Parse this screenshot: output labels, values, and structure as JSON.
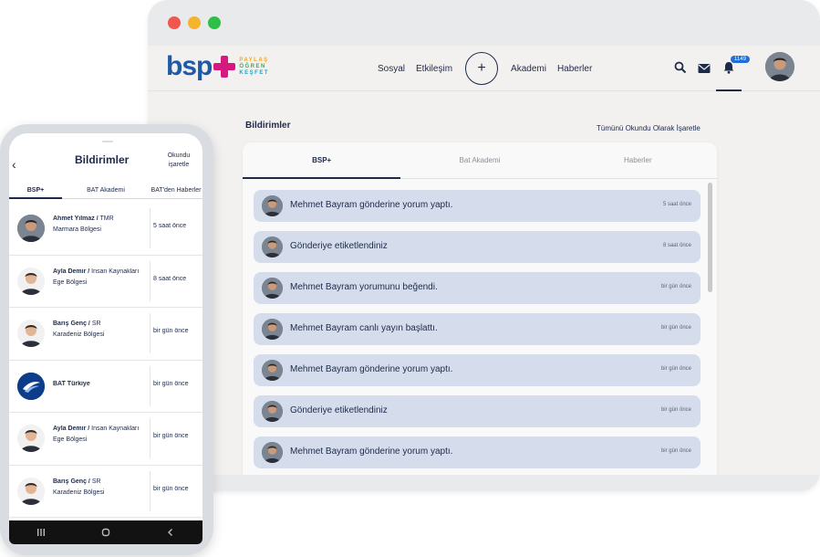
{
  "desktop": {
    "logo": {
      "text": "bsp",
      "tags": [
        "PAYLAŞ",
        "ÖĞREN",
        "KEŞFET"
      ]
    },
    "menu": [
      "Sosyal",
      "Etkileşim",
      "Akademi",
      "Haberler"
    ],
    "plus_label": "+",
    "badge": "1149",
    "page_title": "Bildirimler",
    "mark_all": "Tümünü Okundu Olarak İşaretle",
    "tabs": [
      "BSP+",
      "Bat Akademi",
      "Haberler"
    ],
    "notifications": [
      {
        "text": "Mehmet Bayram gönderine yorum yaptı.",
        "time": "5 saat önce"
      },
      {
        "text": "Gönderiye etiketlendiniz",
        "time": "8 saat önce"
      },
      {
        "text": "Mehmet Bayram yorumunu beğendi.",
        "time": "bir gün önce"
      },
      {
        "text": "Mehmet Bayram canlı yayın başlattı.",
        "time": "bir gün önce"
      },
      {
        "text": "Mehmet Bayram gönderine yorum yaptı.",
        "time": "bir gün önce"
      },
      {
        "text": "Gönderiye etiketlendiniz",
        "time": "bir gün önce"
      },
      {
        "text": "Mehmet Bayram gönderine yorum yaptı.",
        "time": "bir gün önce"
      }
    ]
  },
  "mobile": {
    "back": "‹",
    "title": "Bildirimler",
    "read_label_1": "Okundu",
    "read_label_2": "işaretle",
    "tabs": [
      "BSP+",
      "BAT Akademi",
      "BAT'den Haberler"
    ],
    "items": [
      {
        "name": "Ahmet Yılmaz",
        "role": "TMR",
        "region": "Marmara Bölgesi",
        "time": "5 saat önce"
      },
      {
        "name": "Ayla Demir",
        "role": "İnsan Kaynakları",
        "region": "Ege Bölgesi",
        "time": "8 saat önce"
      },
      {
        "name": "Barış Genç",
        "role": "SR",
        "region": "Karadeniz Bölgesi",
        "time": "bir gün önce"
      },
      {
        "name": "BAT Türkiye",
        "role": "",
        "region": "",
        "time": "bir gün önce"
      },
      {
        "name": "Ayla Demir",
        "role": "İnsan Kaynakları",
        "region": "Ege Bölgesi",
        "time": "bir gün önce"
      },
      {
        "name": "Barış Genç",
        "role": "SR",
        "region": "Karadeniz Bölgesi",
        "time": "bir gün önce"
      }
    ]
  },
  "colors": {
    "navy": "#1d2a4a",
    "brand_blue": "#1e5aa8",
    "brand_pink": "#d6197f",
    "notif_bg": "#d5ddec",
    "badge_blue": "#1e6fd9"
  },
  "icons": [
    "search-icon",
    "mail-icon",
    "bell-icon",
    "back-icon",
    "recents-icon",
    "home-icon",
    "nav-back-icon"
  ]
}
